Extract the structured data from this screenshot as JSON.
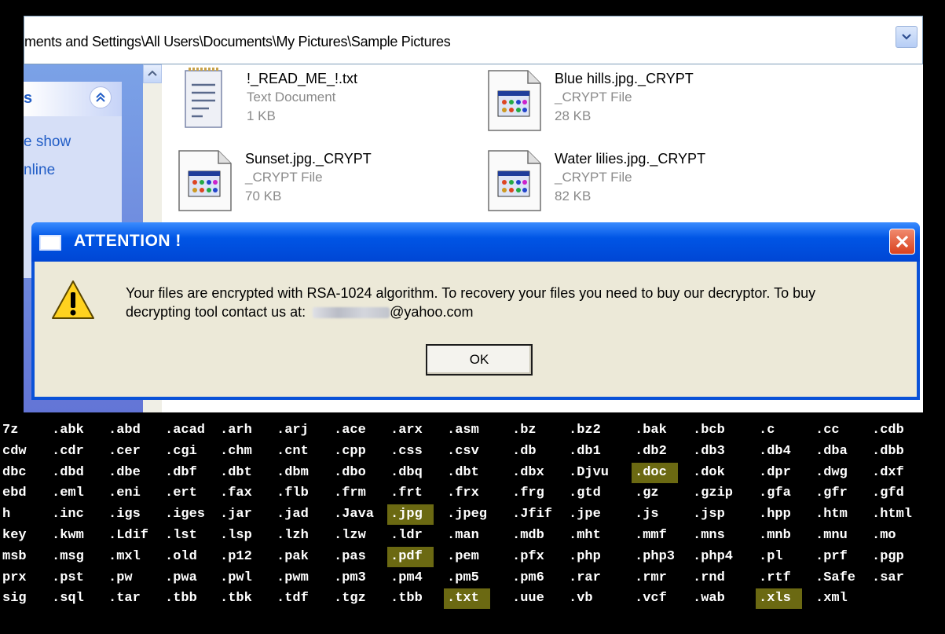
{
  "explorer": {
    "address": "ments and Settings\\All Users\\Documents\\My Pictures\\Sample Pictures",
    "task_header": "s",
    "task_links": [
      "e show",
      "nline"
    ],
    "files": [
      {
        "name": "!_READ_ME_!.txt",
        "type": "Text Document",
        "size": "1 KB",
        "icon": "text-document-icon"
      },
      {
        "name": "Blue hills.jpg._CRYPT",
        "type": "_CRYPT File",
        "size": "28 KB",
        "icon": "crypt-file-icon"
      },
      {
        "name": "Sunset.jpg._CRYPT",
        "type": "_CRYPT File",
        "size": "70 KB",
        "icon": "crypt-file-icon"
      },
      {
        "name": "Water lilies.jpg._CRYPT",
        "type": "_CRYPT File",
        "size": "82 KB",
        "icon": "crypt-file-icon"
      }
    ]
  },
  "dialog": {
    "title": "ATTENTION !",
    "message_line1": "Your files are encrypted with RSA-1024 algorithm.  To recovery your files you need to buy our decryptor.  To buy",
    "message_line2_prefix": "decrypting tool contact us at: ",
    "message_line2_suffix": "@yahoo.com",
    "ok_label": "OK",
    "icons": [
      "warning-icon",
      "close-icon"
    ]
  },
  "extensions": {
    "highlight_color": "#6b6912",
    "rows": [
      [
        "7z",
        ".abk",
        ".abd",
        ".acad",
        ".arh",
        ".arj",
        ".ace",
        ".arx",
        ".asm",
        ".bz",
        ".bz2",
        ".bak",
        ".bcb",
        ".c",
        ".cc",
        ".cdb"
      ],
      [
        "cdw",
        ".cdr",
        ".cer",
        ".cgi",
        ".chm",
        ".cnt",
        ".cpp",
        ".css",
        ".csv",
        ".db",
        ".db1",
        ".db2",
        ".db3",
        ".db4",
        ".dba",
        ".dbb"
      ],
      [
        "dbc",
        ".dbd",
        ".dbe",
        ".dbf",
        ".dbt",
        ".dbm",
        ".dbo",
        ".dbq",
        ".dbt",
        ".dbx",
        ".Djvu",
        ".doc",
        ".dok",
        ".dpr",
        ".dwg",
        ".dxf"
      ],
      [
        "ebd",
        ".eml",
        ".eni",
        ".ert",
        ".fax",
        ".flb",
        ".frm",
        ".frt",
        ".frx",
        ".frg",
        ".gtd",
        ".gz",
        ".gzip",
        ".gfa",
        ".gfr",
        ".gfd"
      ],
      [
        "h",
        ".inc",
        ".igs",
        ".iges",
        ".jar",
        ".jad",
        ".Java",
        ".jpg",
        ".jpeg",
        ".Jfif",
        ".jpe",
        ".js",
        ".jsp",
        ".hpp",
        ".htm",
        ".html"
      ],
      [
        "key",
        ".kwm",
        ".Ldif",
        ".lst",
        ".lsp",
        ".lzh",
        ".lzw",
        ".ldr",
        ".man",
        ".mdb",
        ".mht",
        ".mmf",
        ".mns",
        ".mnb",
        ".mnu",
        ".mo"
      ],
      [
        "msb",
        ".msg",
        ".mxl",
        ".old",
        ".p12",
        ".pak",
        ".pas",
        ".pdf",
        ".pem",
        ".pfx",
        ".php",
        ".php3",
        ".php4",
        ".pl",
        ".prf",
        ".pgp"
      ],
      [
        "prx",
        ".pst",
        ".pw",
        ".pwa",
        ".pwl",
        ".pwm",
        ".pm3",
        ".pm4",
        ".pm5",
        ".pm6",
        ".rar",
        ".rmr",
        ".rnd",
        ".rtf",
        ".Safe",
        ".sar"
      ],
      [
        "sig",
        ".sql",
        ".tar",
        ".tbb",
        ".tbk",
        ".tdf",
        ".tgz",
        ".tbb",
        ".txt",
        ".uue",
        ".vb",
        ".vcf",
        ".wab",
        ".xls",
        ".xml"
      ]
    ],
    "highlighted": [
      ".doc",
      ".jpg",
      ".pdf",
      ".txt",
      ".xls"
    ]
  }
}
